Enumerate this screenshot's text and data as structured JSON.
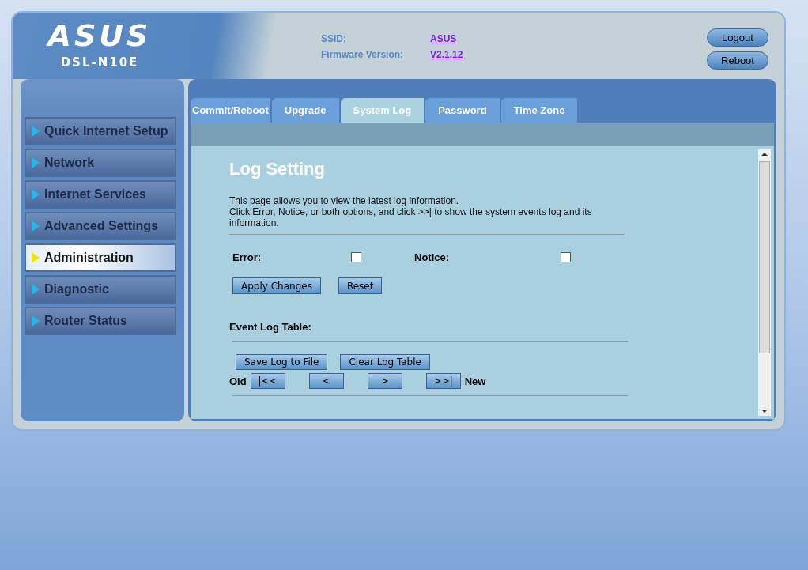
{
  "header": {
    "logo": "ASUS",
    "model": "DSL-N10E",
    "info": [
      {
        "label": "SSID:",
        "value": "ASUS"
      },
      {
        "label": "Firmware Version:",
        "value": "V2.1.12"
      }
    ],
    "buttons": [
      "Logout",
      "Reboot"
    ]
  },
  "sidebar": {
    "items": [
      {
        "label": "Quick Internet Setup",
        "selected": false
      },
      {
        "label": "Network",
        "selected": false
      },
      {
        "label": "Internet Services",
        "selected": false
      },
      {
        "label": "Advanced Settings",
        "selected": false
      },
      {
        "label": "Administration",
        "selected": true
      },
      {
        "label": "Diagnostic",
        "selected": false
      },
      {
        "label": "Router Status",
        "selected": false
      }
    ]
  },
  "tabs": [
    {
      "label": "Commit/Reboot",
      "selected": false
    },
    {
      "label": "Upgrade",
      "selected": false
    },
    {
      "label": "System Log",
      "selected": true
    },
    {
      "label": "Password",
      "selected": false
    },
    {
      "label": "Time Zone",
      "selected": false
    }
  ],
  "content": {
    "title": "Log Setting",
    "description": [
      "This page allows you to view the latest log information.",
      "Click Error, Notice, or both options, and click >>| to show the system events log and its information."
    ],
    "options": [
      {
        "label": "Error:",
        "checked": false
      },
      {
        "label": "Notice:",
        "checked": false
      }
    ],
    "setting_buttons": [
      "Apply Changes",
      "Reset"
    ],
    "event_log_label": "Event Log Table:",
    "log_buttons": [
      "Save Log to File",
      "Clear Log Table"
    ],
    "nav": {
      "old_label": "Old",
      "new_label": "New",
      "buttons": [
        "|<<",
        "<",
        ">",
        ">>|"
      ]
    }
  }
}
